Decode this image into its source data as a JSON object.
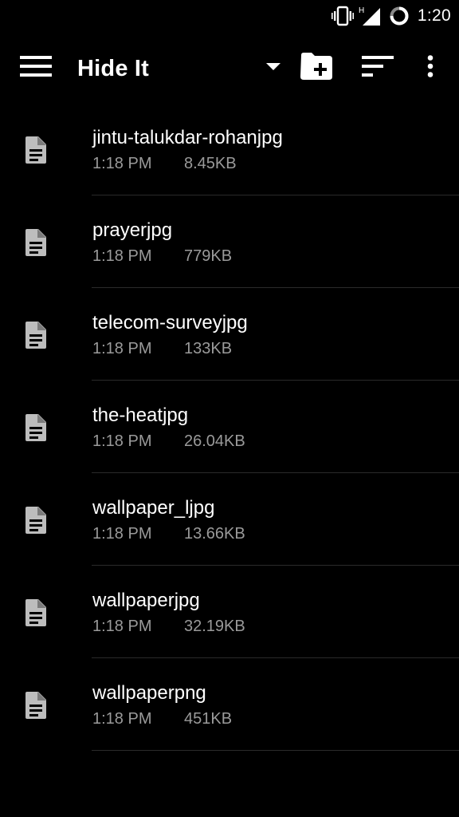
{
  "status_bar": {
    "network_type": "H",
    "time": "1:20",
    "icons": [
      "vibrate-icon",
      "signal-icon",
      "battery-icon"
    ]
  },
  "toolbar": {
    "title": "Hide It",
    "icons": [
      "menu-icon",
      "dropdown-arrow-icon",
      "new-folder-icon",
      "sort-icon",
      "more-vert-icon"
    ]
  },
  "files": [
    {
      "name": "jintu-talukdar-rohanjpg",
      "time": "1:18 PM",
      "size": "8.45KB",
      "icon": "file-icon"
    },
    {
      "name": "prayerjpg",
      "time": "1:18 PM",
      "size": "779KB",
      "icon": "file-icon"
    },
    {
      "name": "telecom-surveyjpg",
      "time": "1:18 PM",
      "size": "133KB",
      "icon": "file-icon"
    },
    {
      "name": "the-heatjpg",
      "time": "1:18 PM",
      "size": "26.04KB",
      "icon": "file-icon"
    },
    {
      "name": "wallpaper_ljpg",
      "time": "1:18 PM",
      "size": "13.66KB",
      "icon": "file-icon"
    },
    {
      "name": "wallpaperjpg",
      "time": "1:18 PM",
      "size": "32.19KB",
      "icon": "file-icon"
    },
    {
      "name": "wallpaperpng",
      "time": "1:18 PM",
      "size": "451KB",
      "icon": "file-icon"
    }
  ],
  "colors": {
    "background": "#000000",
    "primary_text": "#ffffff",
    "secondary_text": "#9a9a9a",
    "icon": "#bdbdbd",
    "divider": "#2a2a2a"
  }
}
